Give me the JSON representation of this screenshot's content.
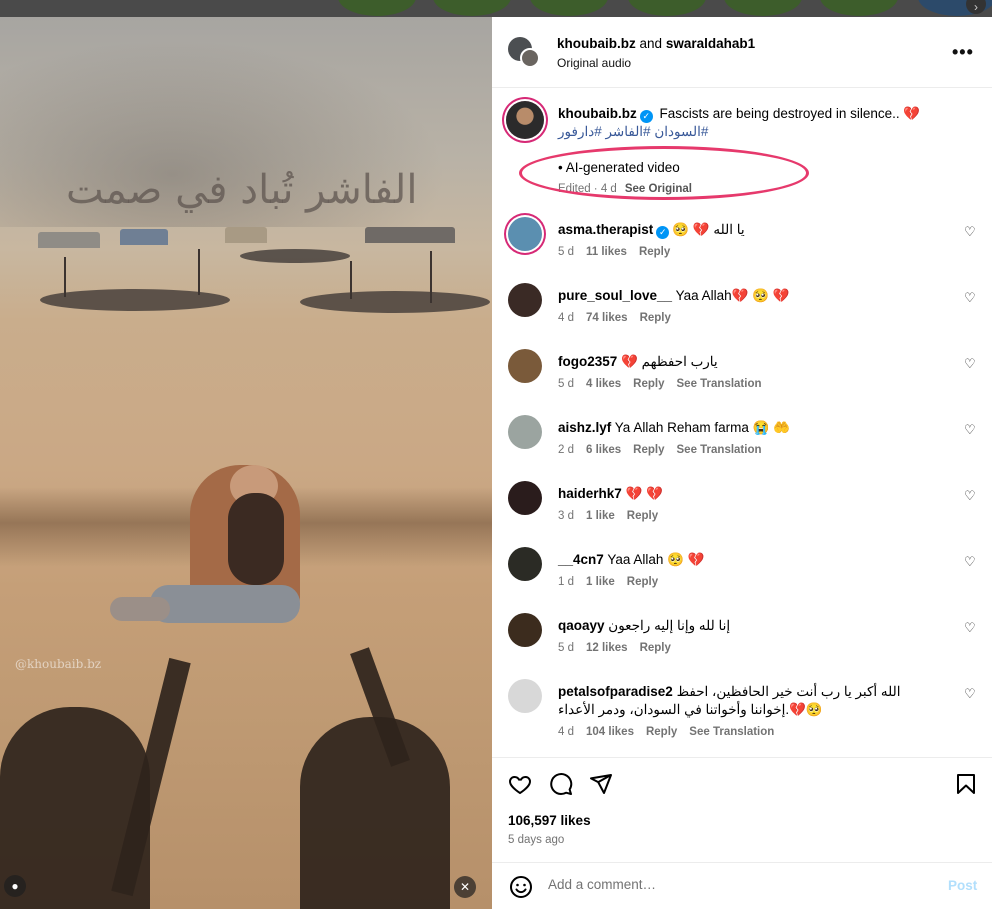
{
  "header": {
    "user1": "khoubaib.bz",
    "conjunction": "and",
    "user2": "swaraldahab1",
    "audio": "Original audio",
    "more_label": "•••"
  },
  "media": {
    "overlay_text": "الفاشر تُباد في صمت",
    "watermark": "@khoubaib.bz"
  },
  "caption": {
    "username": "khoubaib.bz",
    "text": "Fascists are being destroyed in silence..",
    "emoji": "💔",
    "hashtags": "#السودان #الفاشر #دارفور",
    "ai_label": "• AI-generated video",
    "edited": "Edited · 4 d",
    "see_original": "See Original"
  },
  "comments": [
    {
      "username": "asma.therapist",
      "verified": true,
      "text": "🥺 💔 يا الله",
      "age": "5 d",
      "likes": "11 likes",
      "reply": "Reply",
      "translate": ""
    },
    {
      "username": "pure_soul_love__",
      "verified": false,
      "text": "Yaa Allah💔 🥺 💔",
      "age": "4 d",
      "likes": "74 likes",
      "reply": "Reply",
      "translate": ""
    },
    {
      "username": "fogo2357",
      "verified": false,
      "text": "💔 يارب احفظهم",
      "age": "5 d",
      "likes": "4 likes",
      "reply": "Reply",
      "translate": "See Translation"
    },
    {
      "username": "aishz.lyf",
      "verified": false,
      "text": "Ya Allah Reham farma 😭 🤲",
      "age": "2 d",
      "likes": "6 likes",
      "reply": "Reply",
      "translate": "See Translation"
    },
    {
      "username": "haiderhk7",
      "verified": false,
      "text": "💔 💔",
      "age": "3 d",
      "likes": "1 like",
      "reply": "Reply",
      "translate": ""
    },
    {
      "username": "__4cn7",
      "verified": false,
      "text": "Yaa Allah 🥺 💔",
      "age": "1 d",
      "likes": "1 like",
      "reply": "Reply",
      "translate": ""
    },
    {
      "username": "qaoayy",
      "verified": false,
      "text": "إنا لله وإنا إليه راجعون",
      "age": "5 d",
      "likes": "12 likes",
      "reply": "Reply",
      "translate": ""
    },
    {
      "username": "petalsofparadise2",
      "verified": false,
      "text": "الله أكبر يا رب أنت خير الحافظين، احفظ إخواننا وأخواتنا في السودان، ودمر الأعداء.💔🥺",
      "age": "4 d",
      "likes": "104 likes",
      "reply": "Reply",
      "translate": "See Translation"
    }
  ],
  "actions": {
    "likes": "106,597 likes",
    "posted": "5 days ago"
  },
  "composer": {
    "placeholder": "Add a comment…",
    "post_label": "Post"
  },
  "colors": {
    "accent_blue": "#0095f6",
    "hashtag": "#385898",
    "annotation_circle": "#e6396c",
    "post_disabled": "#b2dffc"
  }
}
